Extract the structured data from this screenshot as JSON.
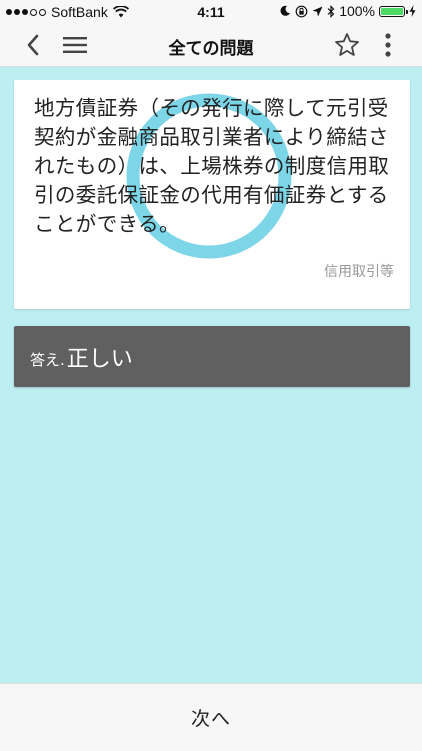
{
  "status_bar": {
    "carrier": "SoftBank",
    "time": "4:11",
    "battery": "100%",
    "battery_level": 1.0
  },
  "nav": {
    "title": "全ての問題",
    "icons": {
      "back": "chevron-left-icon",
      "menu": "hamburger-icon",
      "favorite": "star-icon",
      "more": "more-vertical-icon"
    }
  },
  "question": {
    "text": "地方債証券（その発行に際して元引受契約が金融商品取引業者により締結されたもの）は、上場株券の制度信用取引の委託保証金の代用有価証券とすることができる。",
    "category": "信用取引等"
  },
  "answer": {
    "prefix": "答え.",
    "value": "正しい"
  },
  "bottom": {
    "next_label": "次へ"
  },
  "colors": {
    "background": "#bdeef1",
    "ring": "#7dd5e8",
    "answer_card": "#606060",
    "bar": "#f7f7f7"
  }
}
